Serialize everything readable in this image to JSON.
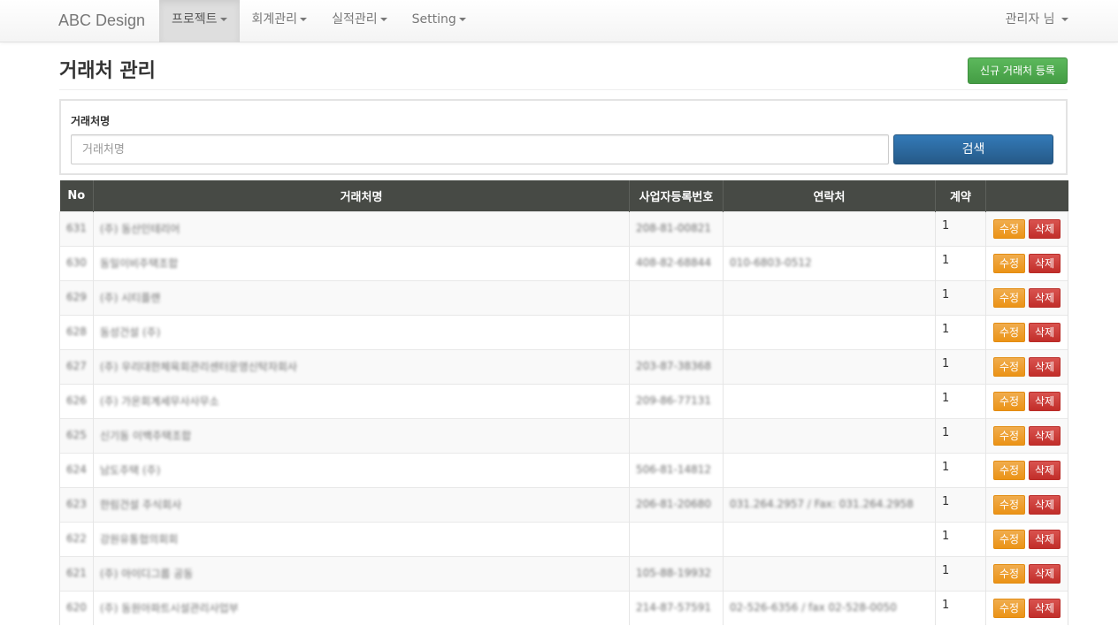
{
  "navbar": {
    "brand": "ABC Design",
    "items": [
      {
        "label": "프로젝트",
        "active": true
      },
      {
        "label": "회계관리",
        "active": false
      },
      {
        "label": "실적관리",
        "active": false
      },
      {
        "label": "Setting",
        "active": false
      }
    ],
    "user": "관리자 님"
  },
  "header": {
    "title": "거래처 관리",
    "new_button": "신규 거래처 등록"
  },
  "search": {
    "label": "거래처명",
    "placeholder": "거래처명",
    "value": "",
    "button": "검색"
  },
  "table": {
    "columns": [
      "No",
      "거래처명",
      "사업자등록번호",
      "연락처",
      "계약",
      ""
    ],
    "edit_label": "수정",
    "delete_label": "삭제",
    "rows": [
      {
        "no": "631",
        "name": "(주) 동산인테리어",
        "biz": "208-81-00821",
        "contact": "",
        "contract": "1"
      },
      {
        "no": "630",
        "name": "동일이비주택조합",
        "biz": "408-82-68844",
        "contact": "010-6803-0512",
        "contract": "1"
      },
      {
        "no": "629",
        "name": "(주) 시티플랜",
        "biz": "",
        "contact": "",
        "contract": "1"
      },
      {
        "no": "628",
        "name": "동성건설 (주)",
        "biz": "",
        "contact": "",
        "contract": "1"
      },
      {
        "no": "627",
        "name": "(주) 우리대한체육회관리센터운영신탁자회사",
        "biz": "203-87-38368",
        "contact": "",
        "contract": "1"
      },
      {
        "no": "626",
        "name": "(주) 가온회계세무사사무소",
        "biz": "209-86-77131",
        "contact": "",
        "contract": "1"
      },
      {
        "no": "625",
        "name": "신기동 이백주택조합",
        "biz": "",
        "contact": "",
        "contract": "1"
      },
      {
        "no": "624",
        "name": "남도주택 (주)",
        "biz": "506-81-14812",
        "contact": "",
        "contract": "1"
      },
      {
        "no": "623",
        "name": "한림건설 주식회사",
        "biz": "206-81-20680",
        "contact": "031.264.2957 / Fax: 031.264.2958",
        "contract": "1"
      },
      {
        "no": "622",
        "name": "강원유통협의회회",
        "biz": "",
        "contact": "",
        "contract": "1"
      },
      {
        "no": "621",
        "name": "(주) 아이디그룹 공동",
        "biz": "105-88-19932",
        "contact": "",
        "contract": "1"
      },
      {
        "no": "620",
        "name": "(주) 동원아파트시설관리사업부",
        "biz": "214-87-57591",
        "contact": "02-526-6356 / fax 02-528-0050",
        "contract": "1"
      }
    ]
  },
  "colors": {
    "navbar_bg": "#f8f8f8",
    "table_header": "#474a45",
    "success": "#5cb85c",
    "primary": "#337ab7",
    "warning": "#f0ad4e",
    "danger": "#d9534f"
  }
}
